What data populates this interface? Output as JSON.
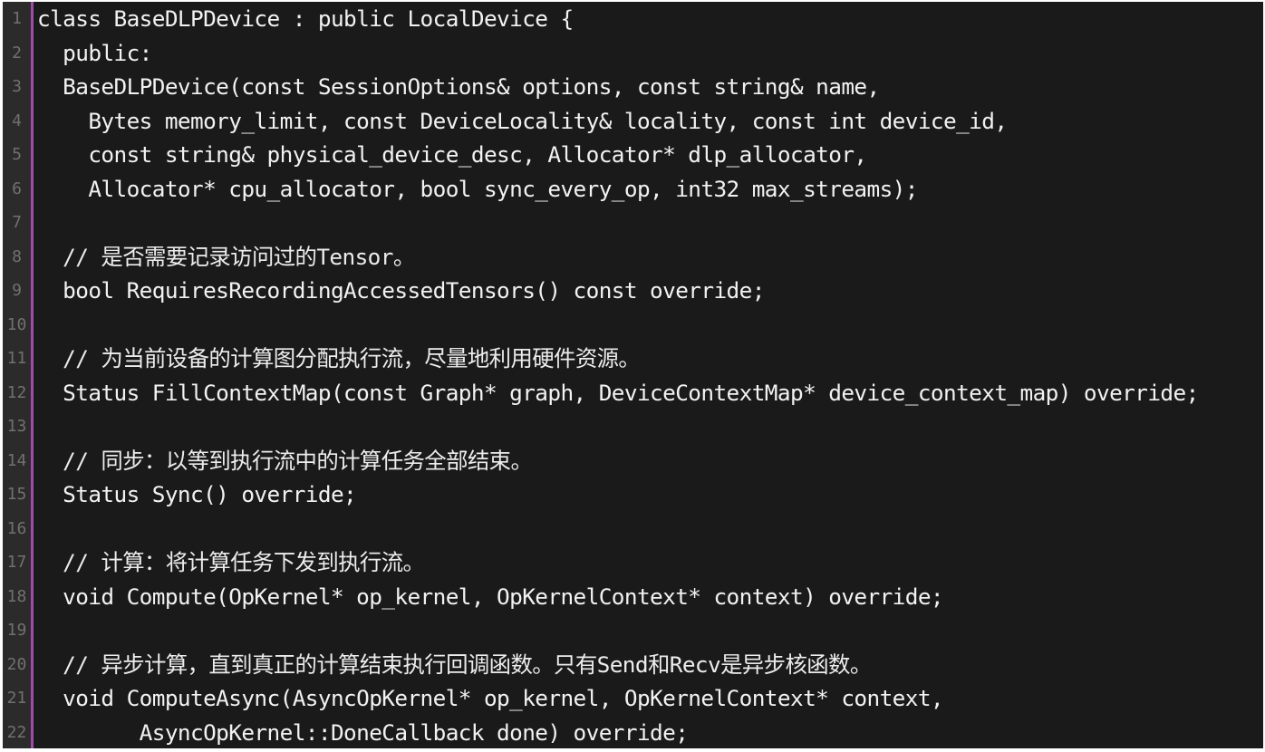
{
  "editor": {
    "colors": {
      "background": "#1a1a1a",
      "gutter": "#2b2b2b",
      "gutter_rule": "#a04ca8",
      "line_number": "#707070",
      "text": "#f2f2f2"
    },
    "watermark_text": "",
    "lines": [
      {
        "number": "1",
        "text": "class BaseDLPDevice : public LocalDevice {"
      },
      {
        "number": "2",
        "text": "  public:"
      },
      {
        "number": "3",
        "text": "  BaseDLPDevice(const SessionOptions& options, const string& name,"
      },
      {
        "number": "4",
        "text": "    Bytes memory_limit, const DeviceLocality& locality, const int device_id,"
      },
      {
        "number": "5",
        "text": "    const string& physical_device_desc, Allocator* dlp_allocator,"
      },
      {
        "number": "6",
        "text": "    Allocator* cpu_allocator, bool sync_every_op, int32 max_streams);"
      },
      {
        "number": "7",
        "text": ""
      },
      {
        "number": "8",
        "text": "  // 是否需要记录访问过的Tensor。"
      },
      {
        "number": "9",
        "text": "  bool RequiresRecordingAccessedTensors() const override;"
      },
      {
        "number": "10",
        "text": ""
      },
      {
        "number": "11",
        "text": "  // 为当前设备的计算图分配执行流，尽量地利用硬件资源。"
      },
      {
        "number": "12",
        "text": "  Status FillContextMap(const Graph* graph, DeviceContextMap* device_context_map) override;"
      },
      {
        "number": "13",
        "text": ""
      },
      {
        "number": "14",
        "text": "  // 同步：以等到执行流中的计算任务全部结束。"
      },
      {
        "number": "15",
        "text": "  Status Sync() override;"
      },
      {
        "number": "16",
        "text": ""
      },
      {
        "number": "17",
        "text": "  // 计算：将计算任务下发到执行流。"
      },
      {
        "number": "18",
        "text": "  void Compute(OpKernel* op_kernel, OpKernelContext* context) override;"
      },
      {
        "number": "19",
        "text": ""
      },
      {
        "number": "20",
        "text": "  // 异步计算，直到真正的计算结束执行回调函数。只有Send和Recv是异步核函数。"
      },
      {
        "number": "21",
        "text": "  void ComputeAsync(AsyncOpKernel* op_kernel, OpKernelContext* context,"
      },
      {
        "number": "22",
        "text": "        AsyncOpKernel::DoneCallback done) override;"
      }
    ]
  }
}
